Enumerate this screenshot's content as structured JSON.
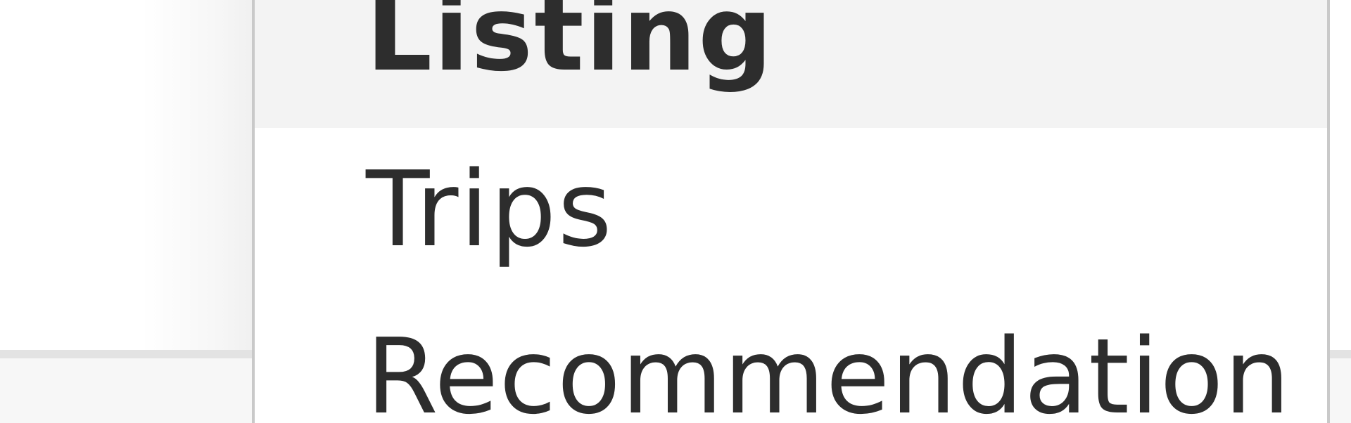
{
  "dropdown": {
    "items": [
      {
        "label": "Listing",
        "state": "highlighted"
      },
      {
        "label": "Trips",
        "state": "normal"
      },
      {
        "label": "Recommendation",
        "state": "normal"
      }
    ]
  },
  "colors": {
    "text": "#2d2d2d",
    "highlight_bg": "#f3f3f3",
    "menu_border": "#c9c9c9",
    "divider": "#e3e3e3"
  }
}
